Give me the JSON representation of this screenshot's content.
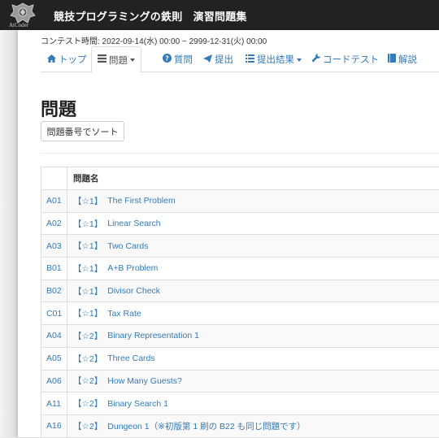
{
  "header": {
    "logo_text": "AtCoder",
    "site_title": "競技プログラミングの鉄則　演習問題集"
  },
  "contest_time": "コンテスト時間: 2022-09-14(水) 00:00 ~ 2999-12-31(火) 00:00",
  "nav": {
    "top": "トップ",
    "tasks": "問題",
    "clarifications": "質問",
    "submit": "提出",
    "results": "提出結果",
    "custom_test": "コードテスト",
    "editorial": "解説"
  },
  "page_title": "問題",
  "sort_button": "問題番号でソート",
  "table": {
    "header_name": "問題名",
    "rows": [
      {
        "id": "A01",
        "level": "【☆1】",
        "name": "The First Problem"
      },
      {
        "id": "A02",
        "level": "【☆1】",
        "name": "Linear Search"
      },
      {
        "id": "A03",
        "level": "【☆1】",
        "name": "Two Cards"
      },
      {
        "id": "B01",
        "level": "【☆1】",
        "name": "A+B Problem"
      },
      {
        "id": "B02",
        "level": "【☆1】",
        "name": "Divisor Check"
      },
      {
        "id": "C01",
        "level": "【☆1】",
        "name": "Tax Rate"
      },
      {
        "id": "A04",
        "level": "【☆2】",
        "name": "Binary Representation 1"
      },
      {
        "id": "A05",
        "level": "【☆2】",
        "name": "Three Cards"
      },
      {
        "id": "A06",
        "level": "【☆2】",
        "name": "How Many Guests?"
      },
      {
        "id": "A11",
        "level": "【☆2】",
        "name": "Binary Search 1"
      },
      {
        "id": "A16",
        "level": "【☆2】",
        "name": "Dungeon 1（※初版第 1 刷の B22 も同じ問題です）"
      }
    ]
  },
  "colors": {
    "link": "#337ab7",
    "topbar": "#222222"
  }
}
